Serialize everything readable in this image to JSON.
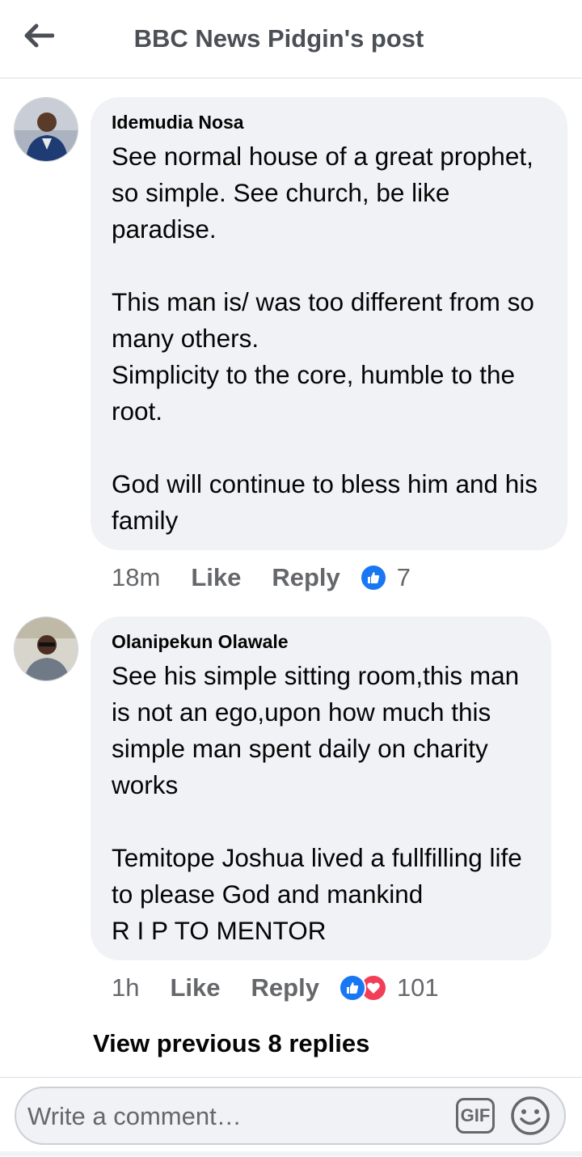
{
  "header": {
    "title": "BBC News Pidgin's post",
    "back_icon": "back-arrow-icon"
  },
  "comments": [
    {
      "author": "Idemudia Nosa",
      "text": "See normal house of a great prophet, so simple. See church, be like paradise.\n\nThis man is/ was too different from so many others.\nSimplicity to the core, humble to the root.\n\nGod will continue to bless him and his family",
      "time": "18m",
      "like_label": "Like",
      "reply_label": "Reply",
      "reactions": [
        "like"
      ],
      "reaction_count": "7"
    },
    {
      "author": "Olanipekun Olawale",
      "text": "See his simple sitting room,this man is not an ego,upon how much this simple man spent daily on charity works\n\nTemitope Joshua lived a fullfilling life to please God and mankind\nR I P TO MENTOR",
      "time": "1h",
      "like_label": "Like",
      "reply_label": "Reply",
      "reactions": [
        "like",
        "love"
      ],
      "reaction_count": "101"
    }
  ],
  "view_previous": "View previous 8 replies",
  "composer": {
    "placeholder": "Write a comment…",
    "gif_label": "GIF",
    "emoji_icon": "smiley-icon"
  },
  "colors": {
    "like_blue": "#1877f2",
    "love_red": "#f33e58",
    "bubble_bg": "#f0f2f5"
  }
}
